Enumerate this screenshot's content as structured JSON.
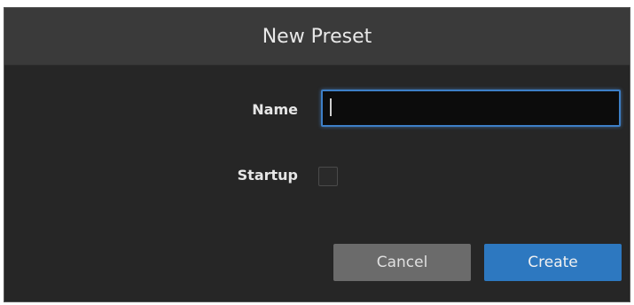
{
  "dialog": {
    "title": "New Preset",
    "fields": {
      "name_label": "Name",
      "name_value": "",
      "startup_label": "Startup",
      "startup_checked": false
    },
    "buttons": {
      "cancel_label": "Cancel",
      "create_label": "Create"
    }
  },
  "colors": {
    "dialog_bg": "#262626",
    "header_bg": "#3a3a3a",
    "input_focus_border": "#3d7fc7",
    "primary_button": "#2d78c0",
    "secondary_button": "#6b6b6b"
  }
}
